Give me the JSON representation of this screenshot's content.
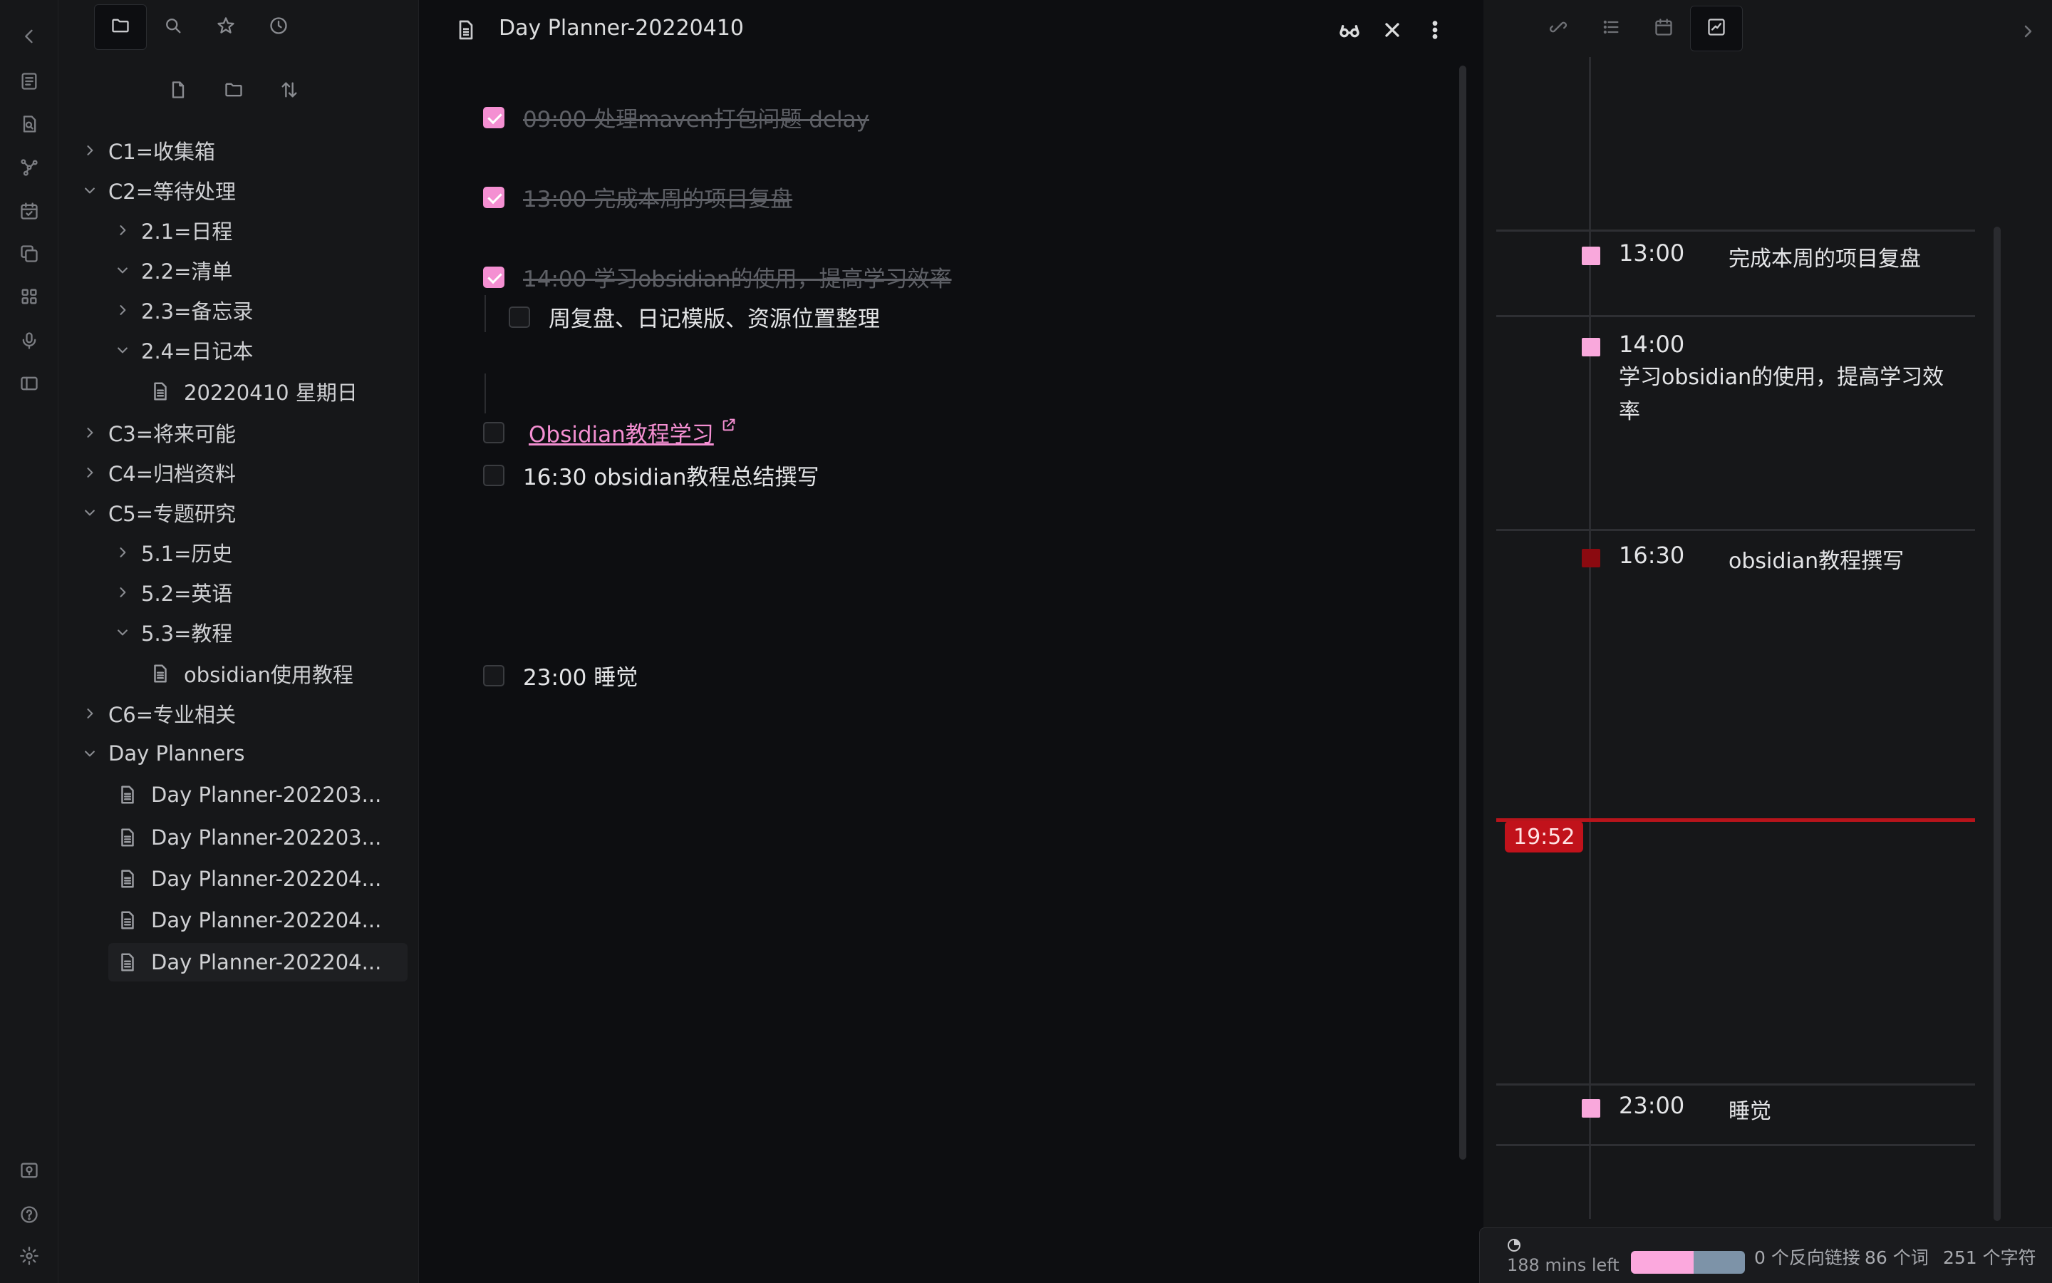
{
  "explorer": {
    "tree": [
      {
        "label": "C1=收集箱"
      },
      {
        "label": "C2=等待处理"
      },
      {
        "label": "2.1=日程"
      },
      {
        "label": "2.2=清单"
      },
      {
        "label": "2.3=备忘录"
      },
      {
        "label": "2.4=日记本"
      },
      {
        "label": "20220410 星期日"
      },
      {
        "label": "C3=将来可能"
      },
      {
        "label": "C4=归档资料"
      },
      {
        "label": "C5=专题研究"
      },
      {
        "label": "5.1=历史"
      },
      {
        "label": "5.2=英语"
      },
      {
        "label": "5.3=教程"
      },
      {
        "label": "obsidian使用教程"
      },
      {
        "label": "C6=专业相关"
      },
      {
        "label": "Day Planners"
      },
      {
        "label": "Day Planner-202203..."
      },
      {
        "label": "Day Planner-202203..."
      },
      {
        "label": "Day Planner-202204..."
      },
      {
        "label": "Day Planner-202204..."
      },
      {
        "label": "Day Planner-202204..."
      }
    ]
  },
  "editor": {
    "title": "Day Planner-20220410",
    "tasks": [
      {
        "text": "09:00 处理maven打包问题 delay"
      },
      {
        "text": "13:00 完成本周的项目复盘"
      },
      {
        "text": "14:00 学习obsidian的使用，提高学习效率"
      },
      {
        "text": "周复盘、日记模版、资源位置整理"
      },
      {
        "text": "Obsidian教程学习"
      },
      {
        "text": "16:30 obsidian教程总结撰写"
      },
      {
        "text": "23:00 睡觉"
      }
    ]
  },
  "timeline": {
    "items": [
      {
        "time": "13:00",
        "text": "完成本周的项目复盘"
      },
      {
        "time": "14:00",
        "text": "学习obsidian的使用，提高学习效率"
      },
      {
        "time": "16:30",
        "text": "obsidian教程撰写"
      },
      {
        "time": "23:00",
        "text": "睡觉"
      }
    ],
    "now": "19:52"
  },
  "statusbar": {
    "mins_left": "188 mins left",
    "progress": 0.55,
    "backlinks": "0 个反向链接",
    "words": "86 个词",
    "chars": "251 个字符"
  },
  "colors": {
    "accent_pink": "#f48fd2",
    "past_item": "#f9a8dc",
    "current_item": "#8b0a10",
    "now_line": "#c1121b"
  }
}
